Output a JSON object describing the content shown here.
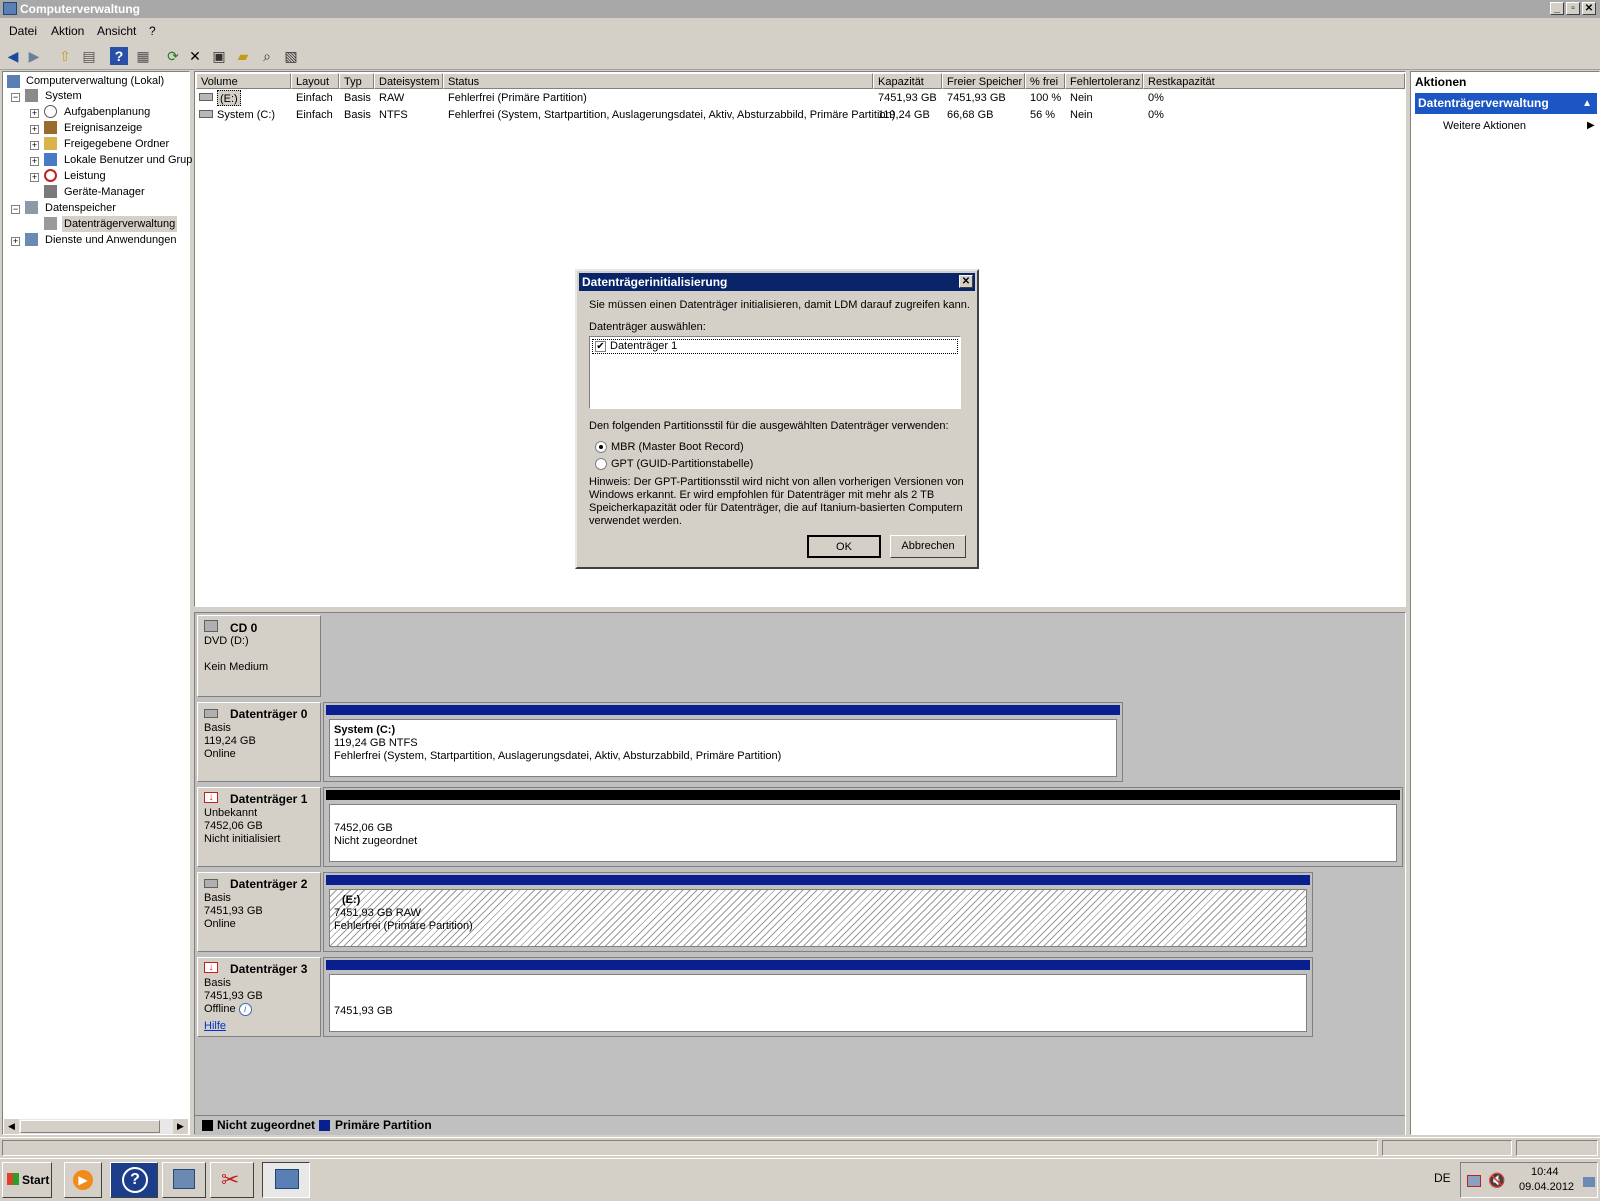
{
  "window": {
    "title": "Computerverwaltung"
  },
  "menu": [
    "Datei",
    "Aktion",
    "Ansicht",
    "?"
  ],
  "tree": {
    "root": "Computerverwaltung (Lokal)",
    "system": "System",
    "aufgaben": "Aufgabenplanung",
    "ereignis": "Ereignisanzeige",
    "freigaben": "Freigegebene Ordner",
    "benutzer": "Lokale Benutzer und Grup",
    "leistung": "Leistung",
    "geraete": "Geräte-Manager",
    "datenspeicher": "Datenspeicher",
    "dtv": "Datenträgerverwaltung",
    "dienste": "Dienste und Anwendungen"
  },
  "volumes": {
    "headers": [
      "Volume",
      "Layout",
      "Typ",
      "Dateisystem",
      "Status",
      "Kapazität",
      "Freier Speicher",
      "% frei",
      "Fehlertoleranz",
      "Restkapazität"
    ],
    "rows": [
      [
        "(E:)",
        "Einfach",
        "Basis",
        "RAW",
        "Fehlerfrei (Primäre Partition)",
        "7451,93 GB",
        "7451,93 GB",
        "100 %",
        "Nein",
        "0%"
      ],
      [
        "System (C:)",
        "Einfach",
        "Basis",
        "NTFS",
        "Fehlerfrei (System, Startpartition, Auslagerungsdatei, Aktiv, Absturzabbild, Primäre Partition)",
        "119,24 GB",
        "66,68 GB",
        "56 %",
        "Nein",
        "0%"
      ]
    ]
  },
  "disks": {
    "cd0": {
      "name": "CD 0",
      "type": "DVD (D:)",
      "status": "Kein Medium"
    },
    "d0": {
      "name": "Datenträger 0",
      "type": "Basis",
      "size": "119,24 GB",
      "status": "Online",
      "part_name": "System  (C:)",
      "part_size": "119,24 GB NTFS",
      "part_status": "Fehlerfrei (System, Startpartition, Auslagerungsdatei, Aktiv, Absturzabbild, Primäre Partition)"
    },
    "d1": {
      "name": "Datenträger 1",
      "type": "Unbekannt",
      "size": "7452,06 GB",
      "status": "Nicht initialisiert",
      "part_size": "7452,06 GB",
      "part_status": "Nicht zugeordnet"
    },
    "d2": {
      "name": "Datenträger 2",
      "type": "Basis",
      "size": "7451,93 GB",
      "status": "Online",
      "part_name": "(E:)",
      "part_size": "7451,93 GB RAW",
      "part_status": "Fehlerfrei (Primäre Partition)"
    },
    "d3": {
      "name": "Datenträger 3",
      "type": "Basis",
      "size": "7451,93 GB",
      "status": "Offline",
      "help": "Hilfe",
      "part_size": "7451,93 GB"
    }
  },
  "legend": {
    "unallocated": "Nicht zugeordnet",
    "primary": "Primäre Partition"
  },
  "actions": {
    "header": "Aktionen",
    "selected": "Datenträgerverwaltung",
    "more": "Weitere Aktionen"
  },
  "dialog": {
    "title": "Datenträgerinitialisierung",
    "intro": "Sie müssen einen Datenträger initialisieren, damit LDM darauf zugreifen kann.",
    "select_label": "Datenträger auswählen:",
    "disk_item": "Datenträger 1",
    "style_label": "Den folgenden Partitionsstil für die ausgewählten Datenträger verwenden:",
    "mbr": "MBR (Master Boot Record)",
    "gpt": "GPT (GUID-Partitionstabelle)",
    "hint1": "Hinweis: Der GPT-Partitionsstil wird nicht von allen vorherigen Versionen von",
    "hint2": "Windows erkannt. Er wird empfohlen für Datenträger mit mehr als 2 TB",
    "hint3": "Speicherkapazität oder für Datenträger, die auf Itanium-basierten Computern",
    "hint4": "verwendet werden.",
    "ok": "OK",
    "cancel": "Abbrechen"
  },
  "taskbar": {
    "start": "Start",
    "lang": "DE",
    "time": "10:44",
    "date": "09.04.2012"
  },
  "colors": {
    "primary_stripe": "#0a1f8f",
    "unallocated_stripe": "#000000",
    "selection": "#1c56c4"
  }
}
